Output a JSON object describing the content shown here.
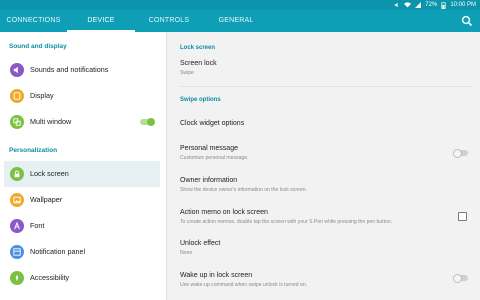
{
  "status": {
    "battery": "72%",
    "time": "10:00 PM"
  },
  "tabs": [
    {
      "label": "CONNECTIONS"
    },
    {
      "label": "DEVICE"
    },
    {
      "label": "CONTROLS"
    },
    {
      "label": "GENERAL"
    }
  ],
  "active_tab": "DEVICE",
  "sidebar": {
    "sections": [
      {
        "title": "Sound and display"
      },
      {
        "title": "Personalization"
      }
    ],
    "items": [
      {
        "label": "Sounds and notifications",
        "icon": "speaker-icon",
        "color": "#8a58c8"
      },
      {
        "label": "Display",
        "icon": "display-icon",
        "color": "#f0a92a"
      },
      {
        "label": "Multi window",
        "icon": "multi-window-icon",
        "color": "#7cc143",
        "toggle": "on"
      },
      {
        "label": "Lock screen",
        "icon": "lock-icon",
        "color": "#7cc143",
        "selected": true
      },
      {
        "label": "Wallpaper",
        "icon": "wallpaper-icon",
        "color": "#f0a92a"
      },
      {
        "label": "Font",
        "icon": "font-icon",
        "color": "#8a58c8"
      },
      {
        "label": "Notification panel",
        "icon": "notification-panel-icon",
        "color": "#4b8fe2"
      },
      {
        "label": "Accessibility",
        "icon": "accessibility-icon",
        "color": "#7cc143"
      }
    ]
  },
  "content": {
    "section_lock": "Lock screen",
    "screen_lock": {
      "title": "Screen lock",
      "value": "Swipe"
    },
    "section_swipe": "Swipe options",
    "clock_widget": {
      "title": "Clock widget options"
    },
    "personal_message": {
      "title": "Personal message",
      "sub": "Customize personal message.",
      "toggle": "off"
    },
    "owner_info": {
      "title": "Owner information",
      "sub": "Show the device owner's information on the lock screen."
    },
    "action_memo": {
      "title": "Action memo on lock screen",
      "sub": "To create action memos, double tap the screen with your S Pen while pressing the pen button.",
      "checked": false
    },
    "unlock_effect": {
      "title": "Unlock effect",
      "value": "None"
    },
    "wake_up": {
      "title": "Wake up in lock screen",
      "sub": "Use wake-up command when swipe unlock is turned on.",
      "toggle": "off"
    }
  },
  "colors": {
    "accent": "#0e9fb7",
    "toggle_on": "#7cc143"
  }
}
